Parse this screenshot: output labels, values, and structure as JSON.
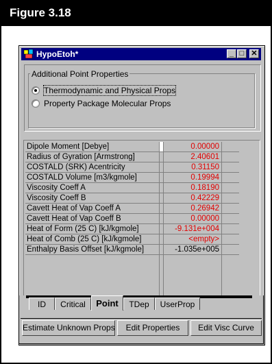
{
  "figure_title": "Figure 3.18",
  "window": {
    "title": "HypoEtoh*",
    "minimize": "_",
    "restore": "□",
    "close": "✕"
  },
  "group": {
    "label": "Additional Point Properties",
    "options": [
      {
        "label": "Thermodynamic and Physical Props",
        "selected": true
      },
      {
        "label": "Property Package Molecular Props",
        "selected": false
      }
    ]
  },
  "properties": [
    {
      "name": "Dipole Moment [Debye]",
      "value": "0.00000"
    },
    {
      "name": "Radius of Gyration [Armstrong]",
      "value": "2.40601"
    },
    {
      "name": "COSTALD (SRK) Acentricity",
      "value": "0.31150"
    },
    {
      "name": "COSTALD Volume [m3/kgmole]",
      "value": "0.19994"
    },
    {
      "name": "Viscosity Coeff A",
      "value": "0.18190"
    },
    {
      "name": "Viscosity Coeff B",
      "value": "0.42229"
    },
    {
      "name": "Cavett Heat of Vap Coeff A",
      "value": "0.26942"
    },
    {
      "name": "Cavett Heat of Vap Coeff B",
      "value": "0.00000"
    },
    {
      "name": "Heat of Form (25 C) [kJ/kgmole]",
      "value": "-9.131e+004"
    },
    {
      "name": "Heat of Comb (25 C) [kJ/kgmole]",
      "value": "<empty>"
    },
    {
      "name": "Enthalpy Basis Offset [kJ/kgmole]",
      "value": "-1.035e+005"
    }
  ],
  "tabs": [
    "ID",
    "Critical",
    "Point",
    "TDep",
    "UserProp"
  ],
  "active_tab": "Point",
  "buttons": {
    "estimate": "Estimate Unknown Props",
    "edit_props": "Edit Properties",
    "edit_visc": "Edit Visc Curve"
  },
  "colors": {
    "value_red": "#e00000",
    "titlebar": "#000080",
    "face": "#c0c0c0"
  }
}
